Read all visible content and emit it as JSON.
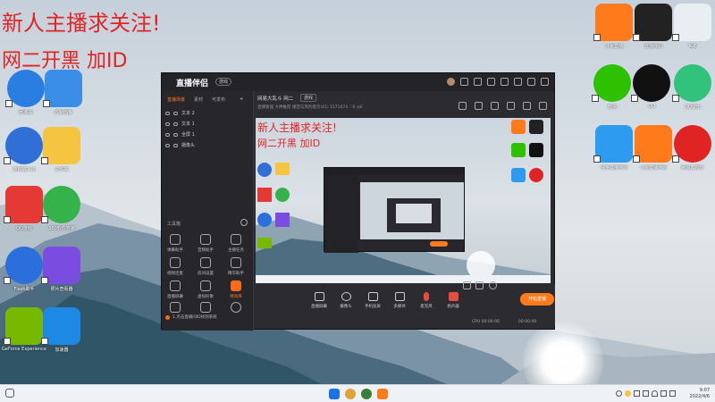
{
  "overlay": {
    "line1": "新人主播求关注!",
    "line2": "网二开黑 加ID"
  },
  "desktop_icons_left": [
    {
      "name": "recycle-bin",
      "label": "回收站",
      "color": "#2a7de1"
    },
    {
      "name": "control-panel",
      "label": "控制面板",
      "color": "#3b8ee8"
    },
    {
      "name": "sogou-input",
      "label": "搜狗输入法",
      "color": "#2f6fd6"
    },
    {
      "name": "folder",
      "label": "文件夹",
      "color": "#f5c542"
    },
    {
      "name": "qq-game",
      "label": "QQ游戏",
      "color": "#e53935"
    },
    {
      "name": "360-drive",
      "label": "360软件管家",
      "color": "#35b34a"
    },
    {
      "name": "flash-center",
      "label": "Flash助手",
      "color": "#2a6fdc"
    },
    {
      "name": "photo-viewer",
      "label": "照片查看器",
      "color": "#7a4ce0"
    },
    {
      "name": "nvidia",
      "label": "GeForce Experience",
      "color": "#76b900"
    },
    {
      "name": "net-tool",
      "label": "加速器",
      "color": "#1e88e5"
    }
  ],
  "desktop_icons_right": [
    {
      "name": "douyu-1",
      "label": "斗鱼直播",
      "color": "#ff7a1a"
    },
    {
      "name": "app-black",
      "label": "直播伴侣",
      "color": "#222222"
    },
    {
      "name": "k-app",
      "label": "K歌",
      "color": "#e9eef3"
    },
    {
      "name": "wechat",
      "label": "微信",
      "color": "#2dc100"
    },
    {
      "name": "qq",
      "label": "QQ",
      "color": "#111111"
    },
    {
      "name": "music",
      "label": "QQ音乐",
      "color": "#31c27c"
    },
    {
      "name": "kuaishou",
      "label": "快手直播伴侣",
      "color": "#2c9bf0"
    },
    {
      "name": "douyu-2",
      "label": "斗鱼直播伴侣",
      "color": "#ff7a1a"
    },
    {
      "name": "netease",
      "label": "网易云音乐",
      "color": "#e02424"
    }
  ],
  "app": {
    "logo": "直播伴侣",
    "badge": "游戏",
    "left_tabs": [
      "直播场景",
      "素材",
      "可发布"
    ],
    "scenes": [
      "文本 2",
      "文本 1",
      "全屏 1",
      "摄像头"
    ],
    "tools_title": "工具箱",
    "tools": [
      "弹幕助手",
      "音频助手",
      "主播任务",
      "视频连麦",
      "房间设置",
      "精华助手",
      "直播屏幕",
      "虚拟形象",
      "特效库",
      "语音设置",
      "礼物",
      "下载"
    ],
    "bottom_hint": "1.点击直播间ID找到系统",
    "room_title": "网易大乱斗 网二",
    "room_tag": "游戏",
    "room_sub": "直播管理  大神推荐  规范与风险提示(41)  1571074  ♡0  ◎0",
    "controls": [
      "直播屏幕",
      "摄像头",
      "手机投屏",
      "多媒体",
      "麦克风",
      "扬声器"
    ],
    "live_button": "开始直播",
    "stat_left": "CPU 00:00:00",
    "stat_right": "00:00:00"
  },
  "taskbar": {
    "time": "9:07",
    "date": "2022/4/6"
  }
}
